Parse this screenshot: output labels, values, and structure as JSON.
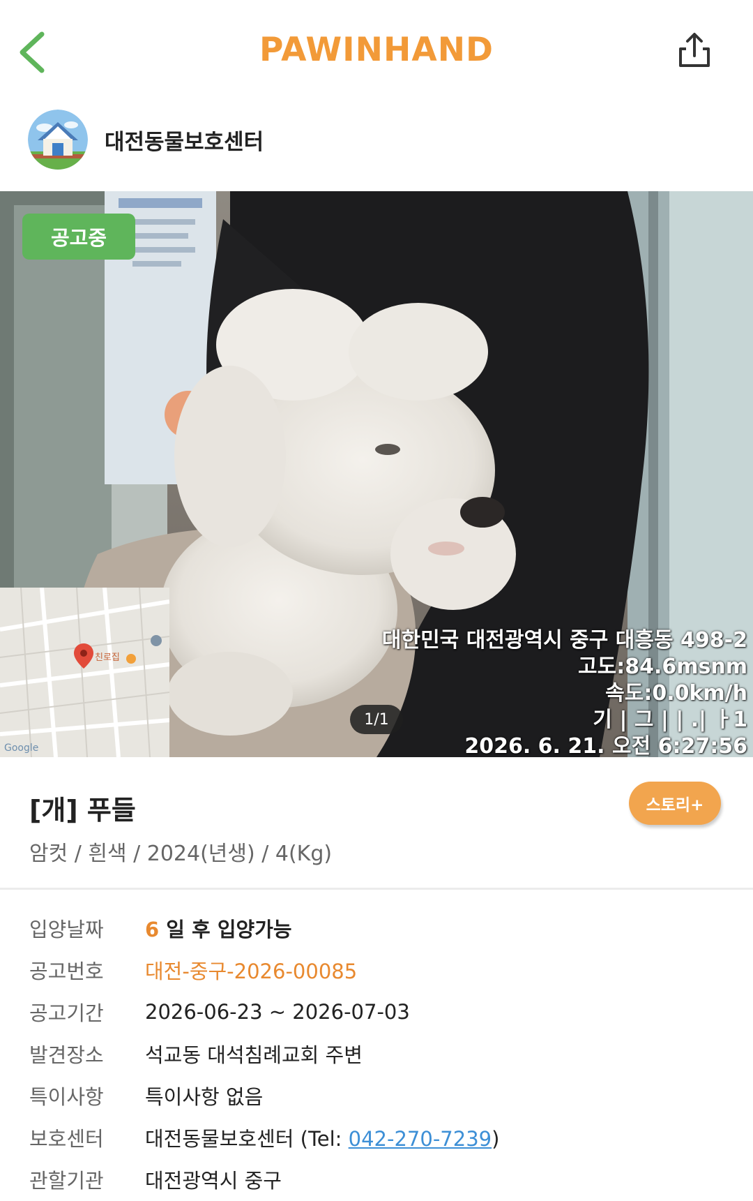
{
  "app": {
    "brand": "PAWINHAND",
    "brand_color": "#F29A38",
    "accent_green": "#5FB55B",
    "accent_orange": "#E8892F"
  },
  "header": {
    "back_icon": "chevron-left-icon",
    "share_icon": "share-icon"
  },
  "shelter": {
    "name": "대전동물보호센터",
    "avatar_icon": "house-icon"
  },
  "photo": {
    "status_badge": "공고중",
    "counter": "1/1",
    "overlay_lines": [
      "대한민국 대전광역시 중구 대흥동 498-2",
      "고도:84.6msnm",
      "속도:0.0km/h",
      "기 | 그 | | .| ㅏ1",
      "2026. 6. 21. 오전 6:27:56"
    ],
    "map_labels": {
      "poi": "친로집",
      "google": "Google"
    }
  },
  "animal": {
    "title": "[개] 푸들",
    "subtitle": "암컷 / 흰색 / 2024(년생) / 4(Kg)",
    "story_button": "스토리+"
  },
  "info": {
    "adopt": {
      "label": "입양날짜",
      "days": "6",
      "suffix": " 일 후 입양가능"
    },
    "notice_no": {
      "label": "공고번호",
      "value": "대전-중구-2026-00085"
    },
    "period": {
      "label": "공고기간",
      "value": "2026-06-23 ~ 2026-07-03"
    },
    "found_place": {
      "label": "발견장소",
      "value": "석교동 대석침례교회 주변"
    },
    "special": {
      "label": "특이사항",
      "value": "특이사항 없음"
    },
    "center": {
      "label": "보호센터",
      "name": "대전동물보호센터 (Tel: ",
      "phone": "042-270-7239",
      "close": ")",
      "phone_color": "#3D8FD6"
    },
    "authority": {
      "label": "관할기관",
      "value": "대전광역시 중구"
    }
  }
}
